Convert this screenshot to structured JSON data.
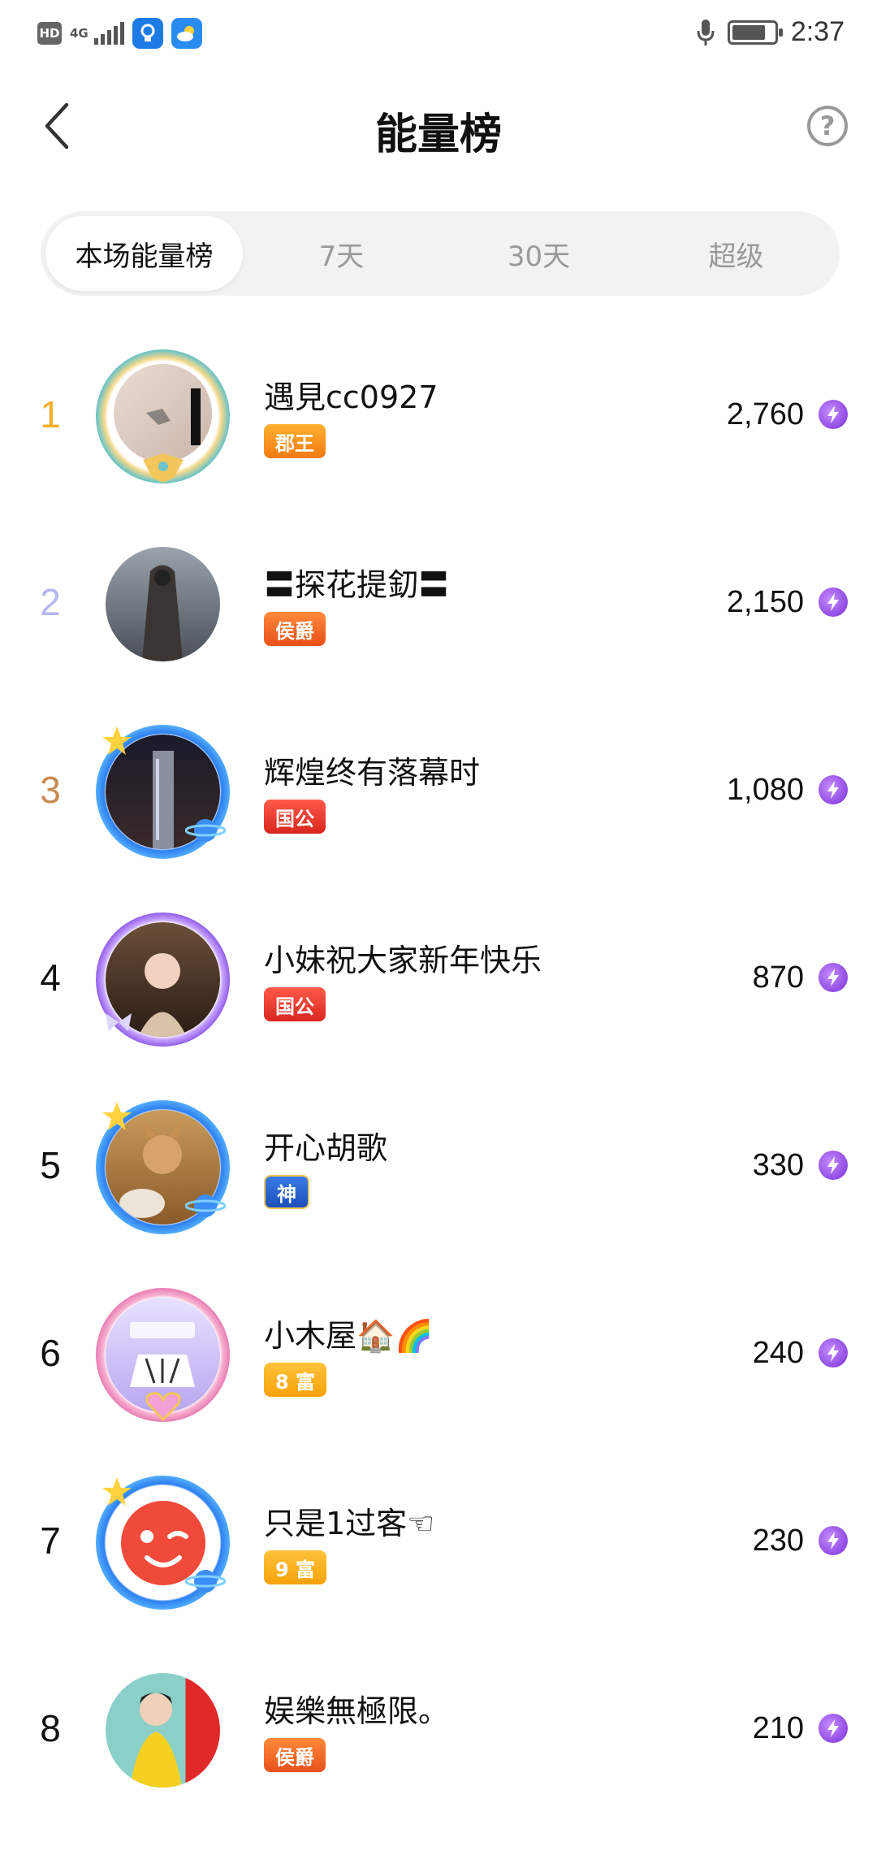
{
  "status_bar": {
    "hd": "HD",
    "network": "4G",
    "time": "2:37"
  },
  "header": {
    "title": "能量榜",
    "help": "?"
  },
  "tabs": [
    {
      "label": "本场能量榜",
      "active": true
    },
    {
      "label": "7天",
      "active": false
    },
    {
      "label": "30天",
      "active": false
    },
    {
      "label": "超级",
      "active": false
    }
  ],
  "colors": {
    "rank1": "#f0b02a",
    "rank2": "#b6b6f0",
    "rank3": "#c8894e",
    "energy": "#8a3ee8"
  },
  "rows": [
    {
      "rank": "1",
      "name": "遇見cc0927",
      "badge": "郡王",
      "score": "2,760"
    },
    {
      "rank": "2",
      "name": "〓探花提釖〓",
      "badge": "侯爵",
      "score": "2,150"
    },
    {
      "rank": "3",
      "name": "辉煌终有落幕时",
      "badge": "国公",
      "score": "1,080"
    },
    {
      "rank": "4",
      "name": "小妹祝大家新年快乐",
      "badge": "国公",
      "score": "870"
    },
    {
      "rank": "5",
      "name": "开心胡歌",
      "badge": "神",
      "score": "330"
    },
    {
      "rank": "6",
      "name": "小木屋🏠🌈",
      "badge": "8 富",
      "score": "240"
    },
    {
      "rank": "7",
      "name": "只是1过客☜",
      "badge": "9 富",
      "score": "230"
    },
    {
      "rank": "8",
      "name": "娱樂無極限。",
      "badge": "侯爵",
      "score": "210"
    }
  ]
}
